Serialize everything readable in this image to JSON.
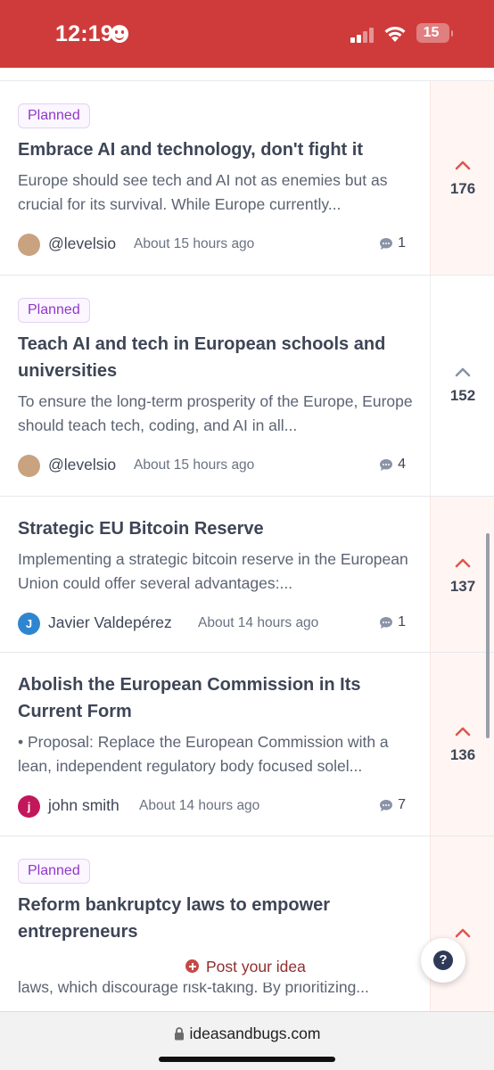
{
  "status_bar": {
    "time": "12:19",
    "battery": "15"
  },
  "ideas": [
    {
      "badge": "Planned",
      "title": "Embrace AI and technology, don't fight it",
      "description": "Europe should see tech and AI not as enemies but as crucial for its survival. While Europe currently...",
      "author": "@levelsio",
      "time_ago": "About 15 hours ago",
      "comments": "1",
      "votes": "176",
      "upvoted": true
    },
    {
      "badge": "Planned",
      "title": "Teach AI and tech in European schools and universities",
      "description": "To ensure the long-term prosperity of the Europe, Europe should teach tech, coding, and AI in all...",
      "author": "@levelsio",
      "time_ago": "About 15 hours ago",
      "comments": "4",
      "votes": "152",
      "upvoted": false
    },
    {
      "title": "Strategic EU Bitcoin Reserve",
      "description": "Implementing a strategic bitcoin reserve in the European Union could offer several advantages:...",
      "author": "Javier Valdepérez",
      "avatar_letter": "J",
      "time_ago": "About 14 hours ago",
      "comments": "1",
      "votes": "137",
      "upvoted": true
    },
    {
      "title": "Abolish the European Commission in Its Current Form",
      "description": "• Proposal: Replace the European Commission with a lean, independent regulatory body focused solel...",
      "author": "john smith",
      "avatar_letter": "j",
      "time_ago": "About 14 hours ago",
      "comments": "7",
      "votes": "136",
      "upvoted": true
    },
    {
      "badge": "Planned",
      "title": "Reform bankruptcy laws to empower entrepreneurs",
      "description": "laws, which discourage risk-taking. By prioritizing...",
      "upvoted": true
    }
  ],
  "post_idea_label": "Post your idea",
  "help_label": "?",
  "browser": {
    "url": "ideasandbugs.com"
  },
  "colors": {
    "status_bar": "#cf3b3b",
    "planned_badge": "#9038c9",
    "upvote_active": "#e0574f",
    "upvote_inactive": "#8a93a6"
  }
}
